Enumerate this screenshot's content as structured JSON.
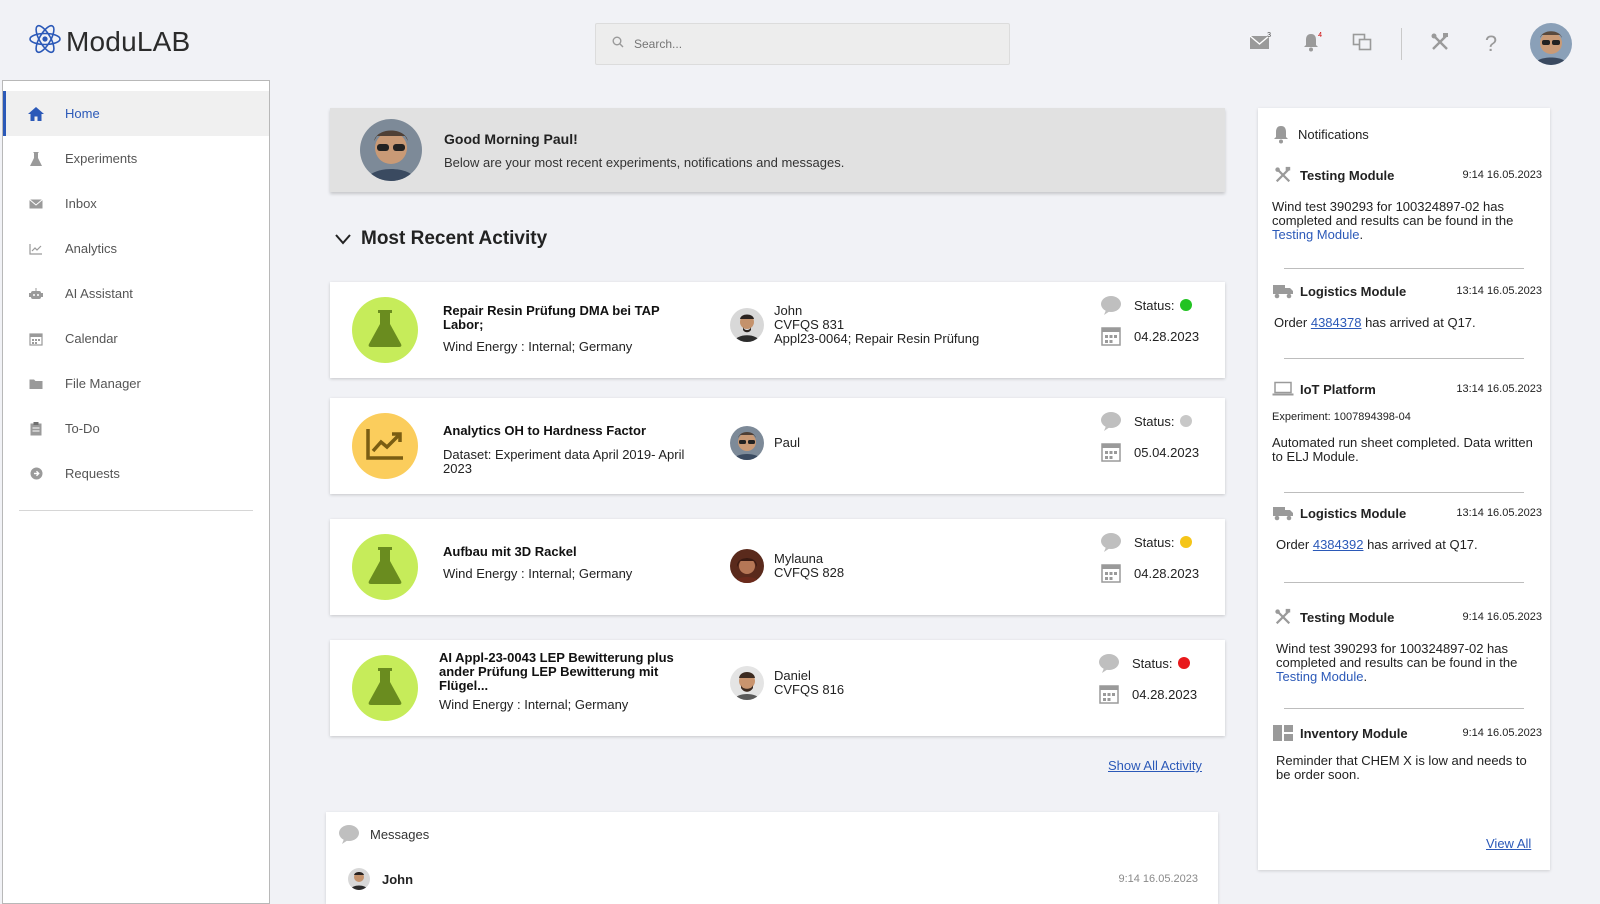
{
  "app": {
    "title": "ModuLAB",
    "accent": "#2b59b8"
  },
  "search": {
    "placeholder": "Search..."
  },
  "header_icons": {
    "mail_badge": "3",
    "bell_badge": "4"
  },
  "sidebar": {
    "items": [
      {
        "label": "Home",
        "icon": "home-icon",
        "active": true
      },
      {
        "label": "Experiments",
        "icon": "flask-icon"
      },
      {
        "label": "Inbox",
        "icon": "envelope-icon"
      },
      {
        "label": "Analytics",
        "icon": "chart-icon"
      },
      {
        "label": "AI Assistant",
        "icon": "robot-icon"
      },
      {
        "label": "Calendar",
        "icon": "calendar-icon"
      },
      {
        "label": "File Manager",
        "icon": "folder-icon"
      },
      {
        "label": "To-Do",
        "icon": "clipboard-icon"
      },
      {
        "label": "Requests",
        "icon": "arrow-circle-icon"
      }
    ]
  },
  "greeting": {
    "title": "Good Morning Paul!",
    "subtitle": "Below are your most recent experiments, notifications and messages."
  },
  "activity": {
    "title": "Most Recent Activity",
    "status_label": "Status:",
    "show_all": "Show All Activity",
    "cards": [
      {
        "title": "Repair Resin Prüfung DMA bei TAP Labor;",
        "subtitle": "Wind Energy : Internal; Germany",
        "person_lines": [
          "John",
          "CVFQS 831",
          "Appl23-0064; Repair Resin Prüfung"
        ],
        "status_color": "#22c322",
        "date": "04.28.2023",
        "icon": "flask-icon",
        "circle": "green"
      },
      {
        "title": "Analytics OH to Hardness Factor",
        "subtitle": "Dataset: Experiment data April 2019- April 2023",
        "person_lines": [
          "Paul"
        ],
        "status_color": "#c8c8c8",
        "date": "05.04.2023",
        "icon": "chart-icon",
        "circle": "yellow"
      },
      {
        "title": "Aufbau mit 3D Rackel",
        "subtitle": "Wind Energy : Internal; Germany",
        "person_lines": [
          "Mylauna",
          "CVFQS 828"
        ],
        "status_color": "#f5c518",
        "date": "04.28.2023",
        "icon": "flask-icon",
        "circle": "green"
      },
      {
        "title": "AI Appl-23-0043 LEP Bewitterung plus ander Prüfung LEP Bewitterung mit Flügel...",
        "subtitle": "Wind Energy : Internal; Germany",
        "person_lines": [
          "Daniel",
          "CVFQS 816"
        ],
        "status_color": "#e8191c",
        "date": "04.28.2023",
        "icon": "flask-icon",
        "circle": "green"
      }
    ]
  },
  "messages": {
    "title": "Messages",
    "items": [
      {
        "name": "John",
        "time": "9:14  16.05.2023"
      }
    ]
  },
  "notifications": {
    "title": "Notifications",
    "view_all": "View All",
    "items": [
      {
        "module": "Testing Module",
        "time": "9:14  16.05.2023",
        "icon": "tools-icon",
        "body_pre": "Wind test 390293 for 100324897-02 has completed and results can be found in the ",
        "link": "Testing Module",
        "body_post": "."
      },
      {
        "module": "Logistics Module",
        "time": "13:14  16.05.2023",
        "icon": "truck-icon",
        "body_pre": "Order ",
        "link": "4384378",
        "body_post": " has arrived at Q17."
      },
      {
        "module": "IoT Platform",
        "time": "13:14  16.05.2023",
        "icon": "laptop-icon",
        "small": "Experiment: 1007894398-04",
        "body": "Automated run sheet completed. Data written to ELJ Module."
      },
      {
        "module": "Logistics Module",
        "time": "13:14  16.05.2023",
        "icon": "truck-icon",
        "body_pre": "Order ",
        "link": "4384392",
        "body_post": " has arrived at Q17."
      },
      {
        "module": "Testing Module",
        "time": "9:14  16.05.2023",
        "icon": "tools-icon",
        "body_pre": "Wind test 390293 for 100324897-02 has completed and results can be found in the ",
        "link": "Testing Module",
        "body_post": "."
      },
      {
        "module": "Inventory Module",
        "time": "9:14  16.05.2023",
        "icon": "inventory-icon",
        "body": "Reminder that CHEM X is low and needs to be order soon."
      }
    ]
  }
}
